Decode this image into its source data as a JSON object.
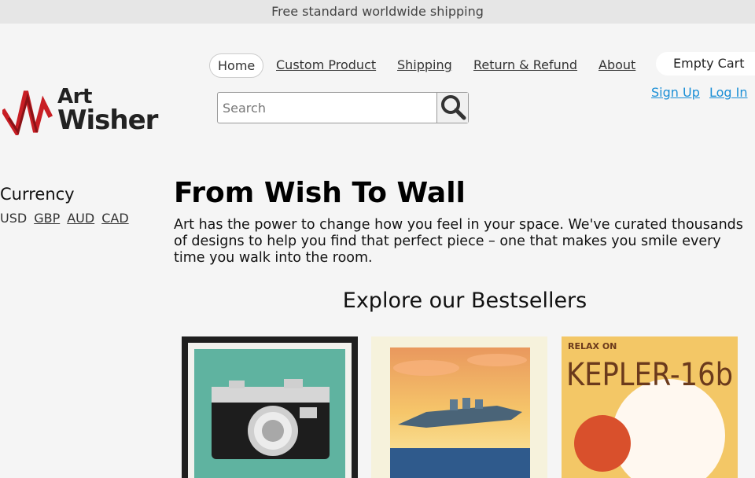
{
  "announcement": "Free standard worldwide shipping",
  "logo": {
    "line1": "Art",
    "line2": "Wisher"
  },
  "nav": {
    "home": "Home",
    "custom_product": "Custom Product",
    "shipping": "Shipping",
    "return_refund": "Return & Refund",
    "about": "About"
  },
  "cart": {
    "label": "Empty Cart"
  },
  "auth": {
    "sign_up": "Sign Up",
    "log_in": "Log In"
  },
  "search": {
    "placeholder": "Search",
    "value": ""
  },
  "currency": {
    "title": "Currency",
    "current": "USD",
    "options": [
      "GBP",
      "AUD",
      "CAD"
    ]
  },
  "hero": {
    "title": "From Wish To Wall",
    "description": "Art has the power to change how you feel in your space. We've curated thousands of designs to help you find that perfect piece – one that makes you smile every time you walk into the room."
  },
  "bestsellers": {
    "heading": "Explore our Bestsellers",
    "products": [
      {
        "art_text": ""
      },
      {
        "art_text": ""
      },
      {
        "art_text_small": "RELAX ON",
        "art_text_big": "KEPLER-16b"
      }
    ]
  },
  "colors": {
    "accent_link": "#1b8fd6",
    "logo_red": "#c81e24",
    "topbar_bg": "#e6e6e6",
    "page_bg": "#f5f5f5"
  }
}
